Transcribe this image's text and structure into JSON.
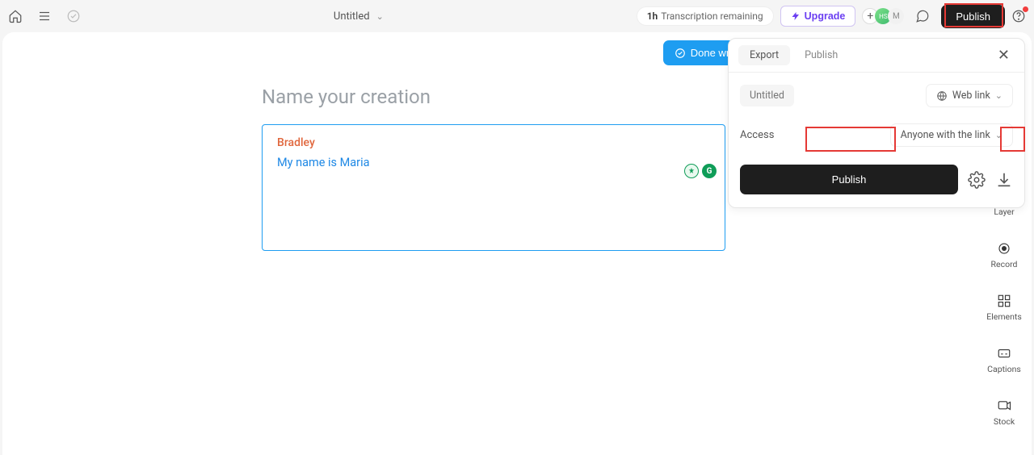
{
  "header": {
    "title": "Untitled",
    "transcription_hours": "1h",
    "transcription_text": "Transcription remaining",
    "upgrade": "Upgrade",
    "avatar_initials_1": "HS",
    "avatar_initials_2": "M",
    "publish": "Publish"
  },
  "main": {
    "done_writing": "Done writing",
    "name_creation_placeholder": "Name your creation",
    "speaker": "Bradley",
    "transcript": "My name is Maria"
  },
  "panel": {
    "tabs": {
      "export": "Export",
      "publish": "Publish"
    },
    "title": "Untitled",
    "web_link": "Web link",
    "access_label": "Access",
    "access_value": "Anyone with the link",
    "publish_btn": "Publish"
  },
  "rail": {
    "layer": "Layer",
    "record": "Record",
    "elements": "Elements",
    "captions": "Captions",
    "stock": "Stock"
  }
}
